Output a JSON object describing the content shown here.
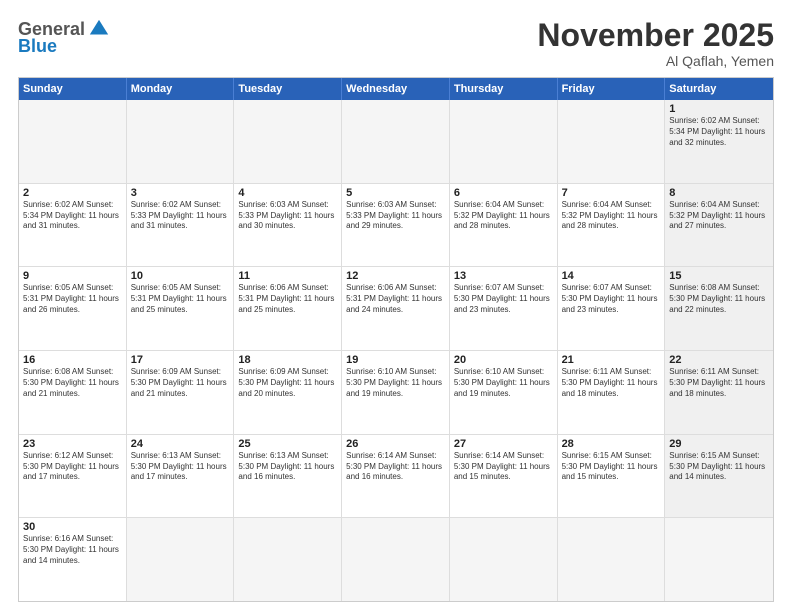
{
  "logo": {
    "general": "General",
    "blue": "Blue"
  },
  "header": {
    "month": "November 2025",
    "location": "Al Qaflah, Yemen"
  },
  "days": [
    "Sunday",
    "Monday",
    "Tuesday",
    "Wednesday",
    "Thursday",
    "Friday",
    "Saturday"
  ],
  "cells": [
    {
      "day": "",
      "empty": true,
      "text": ""
    },
    {
      "day": "",
      "empty": true,
      "text": ""
    },
    {
      "day": "",
      "empty": true,
      "text": ""
    },
    {
      "day": "",
      "empty": true,
      "text": ""
    },
    {
      "day": "",
      "empty": true,
      "text": ""
    },
    {
      "day": "",
      "empty": true,
      "text": ""
    },
    {
      "day": "1",
      "empty": false,
      "shaded": true,
      "text": "Sunrise: 6:02 AM\nSunset: 5:34 PM\nDaylight: 11 hours\nand 32 minutes."
    },
    {
      "day": "2",
      "empty": false,
      "shaded": false,
      "text": "Sunrise: 6:02 AM\nSunset: 5:34 PM\nDaylight: 11 hours\nand 31 minutes."
    },
    {
      "day": "3",
      "empty": false,
      "shaded": false,
      "text": "Sunrise: 6:02 AM\nSunset: 5:33 PM\nDaylight: 11 hours\nand 31 minutes."
    },
    {
      "day": "4",
      "empty": false,
      "shaded": false,
      "text": "Sunrise: 6:03 AM\nSunset: 5:33 PM\nDaylight: 11 hours\nand 30 minutes."
    },
    {
      "day": "5",
      "empty": false,
      "shaded": false,
      "text": "Sunrise: 6:03 AM\nSunset: 5:33 PM\nDaylight: 11 hours\nand 29 minutes."
    },
    {
      "day": "6",
      "empty": false,
      "shaded": false,
      "text": "Sunrise: 6:04 AM\nSunset: 5:32 PM\nDaylight: 11 hours\nand 28 minutes."
    },
    {
      "day": "7",
      "empty": false,
      "shaded": false,
      "text": "Sunrise: 6:04 AM\nSunset: 5:32 PM\nDaylight: 11 hours\nand 28 minutes."
    },
    {
      "day": "8",
      "empty": false,
      "shaded": true,
      "text": "Sunrise: 6:04 AM\nSunset: 5:32 PM\nDaylight: 11 hours\nand 27 minutes."
    },
    {
      "day": "9",
      "empty": false,
      "shaded": false,
      "text": "Sunrise: 6:05 AM\nSunset: 5:31 PM\nDaylight: 11 hours\nand 26 minutes."
    },
    {
      "day": "10",
      "empty": false,
      "shaded": false,
      "text": "Sunrise: 6:05 AM\nSunset: 5:31 PM\nDaylight: 11 hours\nand 25 minutes."
    },
    {
      "day": "11",
      "empty": false,
      "shaded": false,
      "text": "Sunrise: 6:06 AM\nSunset: 5:31 PM\nDaylight: 11 hours\nand 25 minutes."
    },
    {
      "day": "12",
      "empty": false,
      "shaded": false,
      "text": "Sunrise: 6:06 AM\nSunset: 5:31 PM\nDaylight: 11 hours\nand 24 minutes."
    },
    {
      "day": "13",
      "empty": false,
      "shaded": false,
      "text": "Sunrise: 6:07 AM\nSunset: 5:30 PM\nDaylight: 11 hours\nand 23 minutes."
    },
    {
      "day": "14",
      "empty": false,
      "shaded": false,
      "text": "Sunrise: 6:07 AM\nSunset: 5:30 PM\nDaylight: 11 hours\nand 23 minutes."
    },
    {
      "day": "15",
      "empty": false,
      "shaded": true,
      "text": "Sunrise: 6:08 AM\nSunset: 5:30 PM\nDaylight: 11 hours\nand 22 minutes."
    },
    {
      "day": "16",
      "empty": false,
      "shaded": false,
      "text": "Sunrise: 6:08 AM\nSunset: 5:30 PM\nDaylight: 11 hours\nand 21 minutes."
    },
    {
      "day": "17",
      "empty": false,
      "shaded": false,
      "text": "Sunrise: 6:09 AM\nSunset: 5:30 PM\nDaylight: 11 hours\nand 21 minutes."
    },
    {
      "day": "18",
      "empty": false,
      "shaded": false,
      "text": "Sunrise: 6:09 AM\nSunset: 5:30 PM\nDaylight: 11 hours\nand 20 minutes."
    },
    {
      "day": "19",
      "empty": false,
      "shaded": false,
      "text": "Sunrise: 6:10 AM\nSunset: 5:30 PM\nDaylight: 11 hours\nand 19 minutes."
    },
    {
      "day": "20",
      "empty": false,
      "shaded": false,
      "text": "Sunrise: 6:10 AM\nSunset: 5:30 PM\nDaylight: 11 hours\nand 19 minutes."
    },
    {
      "day": "21",
      "empty": false,
      "shaded": false,
      "text": "Sunrise: 6:11 AM\nSunset: 5:30 PM\nDaylight: 11 hours\nand 18 minutes."
    },
    {
      "day": "22",
      "empty": false,
      "shaded": true,
      "text": "Sunrise: 6:11 AM\nSunset: 5:30 PM\nDaylight: 11 hours\nand 18 minutes."
    },
    {
      "day": "23",
      "empty": false,
      "shaded": false,
      "text": "Sunrise: 6:12 AM\nSunset: 5:30 PM\nDaylight: 11 hours\nand 17 minutes."
    },
    {
      "day": "24",
      "empty": false,
      "shaded": false,
      "text": "Sunrise: 6:13 AM\nSunset: 5:30 PM\nDaylight: 11 hours\nand 17 minutes."
    },
    {
      "day": "25",
      "empty": false,
      "shaded": false,
      "text": "Sunrise: 6:13 AM\nSunset: 5:30 PM\nDaylight: 11 hours\nand 16 minutes."
    },
    {
      "day": "26",
      "empty": false,
      "shaded": false,
      "text": "Sunrise: 6:14 AM\nSunset: 5:30 PM\nDaylight: 11 hours\nand 16 minutes."
    },
    {
      "day": "27",
      "empty": false,
      "shaded": false,
      "text": "Sunrise: 6:14 AM\nSunset: 5:30 PM\nDaylight: 11 hours\nand 15 minutes."
    },
    {
      "day": "28",
      "empty": false,
      "shaded": false,
      "text": "Sunrise: 6:15 AM\nSunset: 5:30 PM\nDaylight: 11 hours\nand 15 minutes."
    },
    {
      "day": "29",
      "empty": false,
      "shaded": true,
      "text": "Sunrise: 6:15 AM\nSunset: 5:30 PM\nDaylight: 11 hours\nand 14 minutes."
    },
    {
      "day": "30",
      "empty": false,
      "shaded": false,
      "text": "Sunrise: 6:16 AM\nSunset: 5:30 PM\nDaylight: 11 hours\nand 14 minutes."
    },
    {
      "day": "",
      "empty": true,
      "text": ""
    },
    {
      "day": "",
      "empty": true,
      "text": ""
    },
    {
      "day": "",
      "empty": true,
      "text": ""
    },
    {
      "day": "",
      "empty": true,
      "text": ""
    },
    {
      "day": "",
      "empty": true,
      "text": ""
    },
    {
      "day": "",
      "empty": true,
      "text": ""
    }
  ]
}
